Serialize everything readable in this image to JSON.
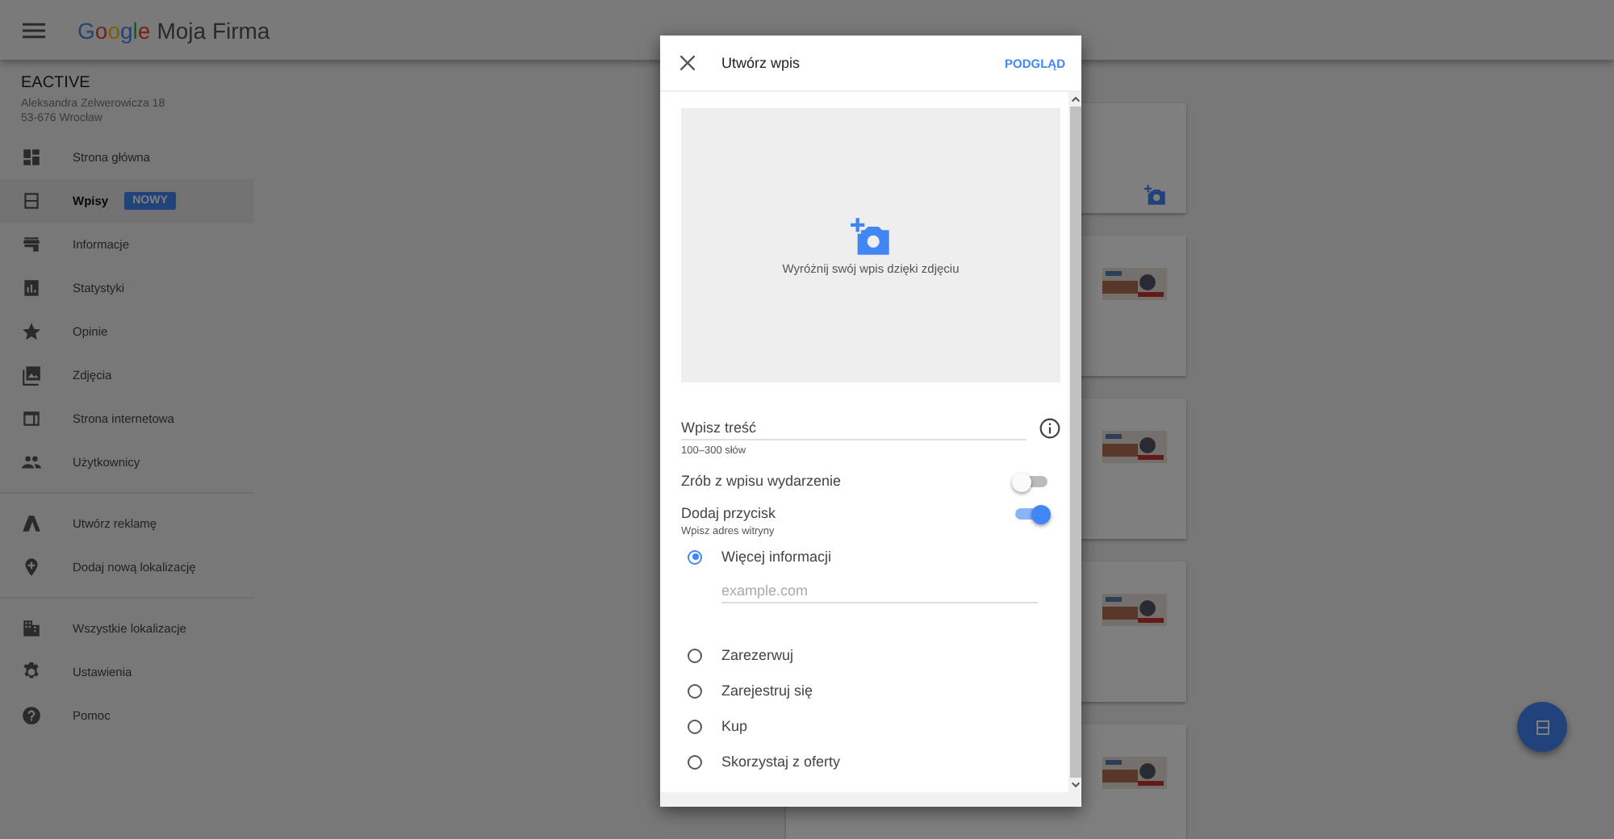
{
  "header": {
    "logo": "Google",
    "title": "Moja Firma"
  },
  "business": {
    "name": "EACTIVE",
    "address_lines": [
      "Aleksandra Zelwerowicza 18",
      "53-676 Wrocław"
    ]
  },
  "sidebar": {
    "groups": [
      [
        {
          "label": "Strona główna",
          "selected": false
        },
        {
          "label": "Wpisy",
          "selected": true,
          "badge": "NOWY"
        },
        {
          "label": "Informacje",
          "selected": false
        },
        {
          "label": "Statystyki",
          "selected": false
        },
        {
          "label": "Opinie",
          "selected": false
        },
        {
          "label": "Zdjęcia",
          "selected": false
        },
        {
          "label": "Strona internetowa",
          "selected": false
        },
        {
          "label": "Użytkownicy",
          "selected": false
        }
      ],
      [
        {
          "label": "Utwórz reklamę",
          "selected": false
        },
        {
          "label": "Dodaj nową lokalizację",
          "selected": false
        }
      ],
      [
        {
          "label": "Wszystkie lokalizacje",
          "selected": false
        },
        {
          "label": "Ustawienia",
          "selected": false
        },
        {
          "label": "Pomoc",
          "selected": false
        }
      ]
    ]
  },
  "posts": [
    {
      "kind": "add"
    },
    {
      "kind": "picture"
    },
    {
      "kind": "picture"
    },
    {
      "kind": "picture"
    },
    {
      "kind": "picture"
    }
  ],
  "dialog": {
    "title": "Utwórz wpis",
    "action": "PODGLĄD",
    "photo_hint": "Wyróżnij swój wpis dzięki zdjęciu",
    "content_field": {
      "placeholder": "Wpisz treść",
      "hint": "100–300 słów"
    },
    "toggles": [
      {
        "label": "Zrób z wpisu wydarzenie",
        "on": false
      },
      {
        "label": "Dodaj przycisk",
        "on": true,
        "hint": "Wpisz adres witryny"
      }
    ],
    "button_options": [
      {
        "label": "Więcej informacji",
        "selected": true,
        "url_placeholder": "example.com"
      },
      {
        "label": "Zarezerwuj",
        "selected": false
      },
      {
        "label": "Zarejestruj się",
        "selected": false
      },
      {
        "label": "Kup",
        "selected": false
      },
      {
        "label": "Skorzystaj z oferty",
        "selected": false
      }
    ]
  }
}
